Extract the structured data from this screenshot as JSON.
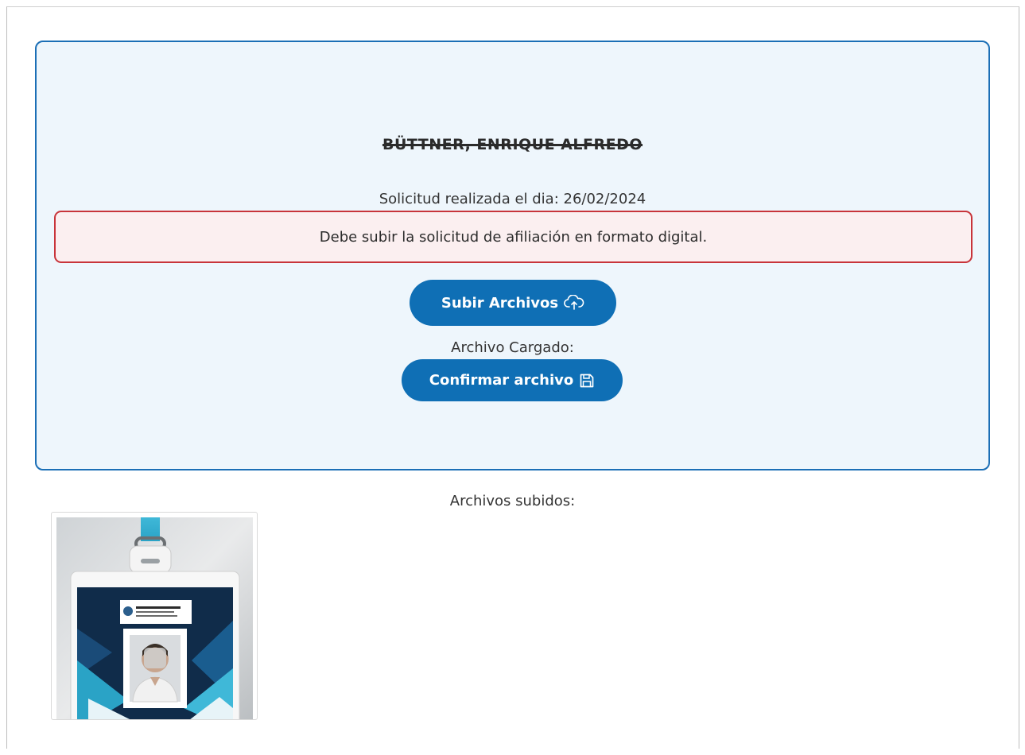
{
  "applicant": {
    "name": "BÜTTNER, ENRIQUE ALFREDO",
    "request_date": "Solicitud realizada el dia: 26/02/2024"
  },
  "alert": {
    "message": "Debe subir la solicitud de afiliación en formato digital."
  },
  "actions": {
    "upload_label": "Subir Archivos",
    "upload_icon": "cloud-upload-icon",
    "loaded_label": "Archivo Cargado:",
    "confirm_label": "Confirmar archivo",
    "confirm_icon": "save-icon"
  },
  "uploads": {
    "title": "Archivos subidos:",
    "files": [
      {
        "kind": "image",
        "preview": "id-badge-photo"
      }
    ]
  },
  "colors": {
    "primary": "#0f6fb5",
    "card_border": "#1b6fb6",
    "card_bg": "#eef6fc",
    "alert_border": "#c8343a",
    "alert_bg": "#fbeff0"
  }
}
